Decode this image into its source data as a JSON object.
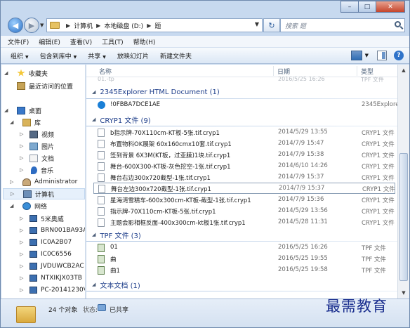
{
  "window": {
    "caption": {
      "minimize": "–",
      "maximize": "□",
      "close": "✕"
    }
  },
  "address_bar": {
    "crumbs": [
      "计算机",
      "本地磁盘 (D:)",
      "题"
    ],
    "search_placeholder": "搜索 题"
  },
  "menu": [
    "文件(F)",
    "编辑(E)",
    "查看(V)",
    "工具(T)",
    "帮助(H)"
  ],
  "toolbar": {
    "organize": "组织",
    "include_in_library": "包含到库中",
    "share": "共享",
    "slideshow": "放映幻灯片",
    "new_folder": "新建文件夹"
  },
  "sidebar": {
    "favorites": "收藏夹",
    "recent": "最近访问的位置",
    "desktop": "桌面",
    "library": "库",
    "videos": "视频",
    "pictures": "图片",
    "documents": "文档",
    "music": "音乐",
    "user": "Administrator",
    "computer": "计算机",
    "network": "网络",
    "hosts": [
      "5米奥威",
      "BRN001BA93A",
      "IC0A2B07",
      "IC0C6556",
      "JVDUWCB2AC",
      "NTXIKJX03TB",
      "PC-20141230V"
    ]
  },
  "columns": {
    "name": "名称",
    "date": "日期",
    "type": "类型"
  },
  "ghost_row": {
    "name": "01.-tp",
    "date": "2016/5/25 16:26",
    "type": "TPF 文件"
  },
  "groups": [
    {
      "title": "2345Explorer HTML Document (1)",
      "files": [
        {
          "name": "!0FBBA7DCE1AE",
          "date": "",
          "type": "2345Explore",
          "icon": "html-icon"
        }
      ]
    },
    {
      "title": "CRYP1 文件 (9)",
      "files": [
        {
          "name": "b指示牌-70X110cm-KT板-5张.tif.cryp1",
          "date": "2014/5/29 13:55",
          "type": "CRYP1 文件",
          "icon": "file-icon"
        },
        {
          "name": "布置物料OK展架 60x160cmx10套.tif.cryp1",
          "date": "2014/7/9 15:47",
          "type": "CRYP1 文件",
          "icon": "file-icon"
        },
        {
          "name": "签到背景 6X3M(KT板，过亚膜)1块.tif.cryp1",
          "date": "2014/7/9 15:38",
          "type": "CRYP1 文件",
          "icon": "file-icon"
        },
        {
          "name": "舞台-600X300-KT板-灰色挖空-1张.tif.cryp1",
          "date": "2014/6/10 14:26",
          "type": "CRYP1 文件",
          "icon": "file-icon"
        },
        {
          "name": "舞台右边300x720截型-1张.tif.cryp1",
          "date": "2014/7/9 15:37",
          "type": "CRYP1 文件",
          "icon": "file-icon"
        },
        {
          "name": "舞台左边300x720截型-1张.tif.cryp1",
          "date": "2014/7/9 15:37",
          "type": "CRYP1 文件",
          "icon": "file-icon",
          "selected": true
        },
        {
          "name": "星海湾雪糕车-600x300cm-KT板-截型-1张.tif.cryp1",
          "date": "2014/7/9 15:36",
          "type": "CRYP1 文件",
          "icon": "file-icon"
        },
        {
          "name": "指示牌-70X110cm-KT板-5张.tif.cryp1",
          "date": "2014/5/29 13:56",
          "type": "CRYP1 文件",
          "icon": "file-icon"
        },
        {
          "name": "主题会影相框反面-400x300cm-kt板1张.tif.cryp1",
          "date": "2014/5/28 11:31",
          "type": "CRYP1 文件",
          "icon": "file-icon"
        }
      ]
    },
    {
      "title": "TPF 文件 (3)",
      "files": [
        {
          "name": "01",
          "date": "2016/5/25 16:26",
          "type": "TPF 文件",
          "icon": "tpf-icon"
        },
        {
          "name": "曲",
          "date": "2016/5/25 19:55",
          "type": "TPF 文件",
          "icon": "tpf-icon"
        },
        {
          "name": "曲1",
          "date": "2016/5/25 19:58",
          "type": "TPF 文件",
          "icon": "tpf-icon"
        }
      ]
    },
    {
      "title": "文本文档 (1)",
      "files": []
    }
  ],
  "status": {
    "count": "24 个对象",
    "state_label": "状态:",
    "shared": "已共享"
  },
  "watermark": "最需教育"
}
